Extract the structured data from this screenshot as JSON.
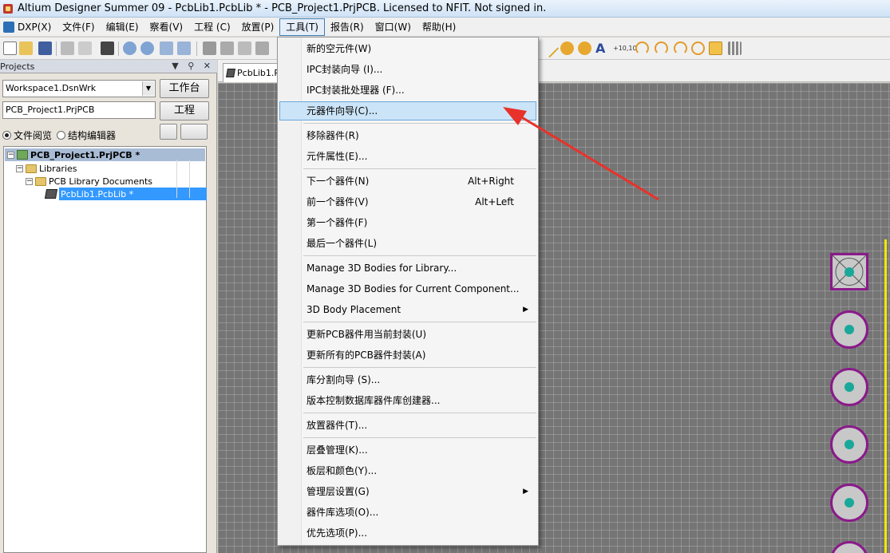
{
  "window": {
    "title": "Altium Designer Summer 09 - PcbLib1.PcbLib * - PCB_Project1.PrjPCB. Licensed to NFIT. Not signed in."
  },
  "menubar": {
    "items": [
      {
        "label": "DXP(X)"
      },
      {
        "label": "文件(F)"
      },
      {
        "label": "编辑(E)"
      },
      {
        "label": "察看(V)"
      },
      {
        "label": "工程 (C)"
      },
      {
        "label": "放置(P)"
      },
      {
        "label": "工具(T)"
      },
      {
        "label": "报告(R)"
      },
      {
        "label": "窗口(W)"
      },
      {
        "label": "帮助(H)"
      }
    ]
  },
  "projects_panel": {
    "title": "Projects",
    "header_icons": "▼ ⚲ ✕",
    "workspace_value": "Workspace1.DsnWrk",
    "project_value": "PCB_Project1.PrjPCB",
    "workspace_button": "工作台",
    "project_button": "工程",
    "radio_file_view": "文件阅览",
    "radio_structure": "结构编辑器",
    "tree": {
      "project": "PCB_Project1.PrjPCB *",
      "libraries": "Libraries",
      "pcb_library_docs": "PCB Library Documents",
      "pcblib": "PcbLib1.PcbLib *"
    }
  },
  "doc_tab": {
    "label": "PcbLib1.P"
  },
  "tools_menu": {
    "items": [
      {
        "label": "新的空元件(W)",
        "shortcut": ""
      },
      {
        "label": "IPC封装向导 (I)...",
        "shortcut": ""
      },
      {
        "label": "IPC封装批处理器 (F)...",
        "shortcut": ""
      },
      {
        "label": "元器件向导(C)...",
        "shortcut": ""
      },
      {
        "label": "移除器件(R)",
        "shortcut": ""
      },
      {
        "label": "元件属性(E)...",
        "shortcut": ""
      },
      {
        "label": "下一个器件(N)",
        "shortcut": "Alt+Right"
      },
      {
        "label": "前一个器件(V)",
        "shortcut": "Alt+Left"
      },
      {
        "label": "第一个器件(F)",
        "shortcut": ""
      },
      {
        "label": "最后一个器件(L)",
        "shortcut": ""
      },
      {
        "label": "Manage 3D Bodies for Library...",
        "shortcut": ""
      },
      {
        "label": "Manage 3D Bodies for Current Component...",
        "shortcut": ""
      },
      {
        "label": "3D Body Placement",
        "shortcut": ""
      },
      {
        "label": "更新PCB器件用当前封装(U)",
        "shortcut": ""
      },
      {
        "label": "更新所有的PCB器件封装(A)",
        "shortcut": ""
      },
      {
        "label": "库分割向导 (S)...",
        "shortcut": ""
      },
      {
        "label": "版本控制数据库器件库创建器...",
        "shortcut": ""
      },
      {
        "label": "放置器件(T)...",
        "shortcut": ""
      },
      {
        "label": "层叠管理(K)...",
        "shortcut": ""
      },
      {
        "label": "板层和颜色(Y)...",
        "shortcut": ""
      },
      {
        "label": "管理层设置(G)",
        "shortcut": ""
      },
      {
        "label": "器件库选项(O)...",
        "shortcut": ""
      },
      {
        "label": "优先选项(P)...",
        "shortcut": ""
      }
    ],
    "submenu_arrow": "▶",
    "highlighted": "元器件向导(C)..."
  },
  "colors": {
    "highlight": "#cce4f7",
    "arrow": "#e8322a",
    "pad_border": "#8a1a8a",
    "pad_hole": "#1aa89a",
    "board_edge": "#f3e600"
  }
}
